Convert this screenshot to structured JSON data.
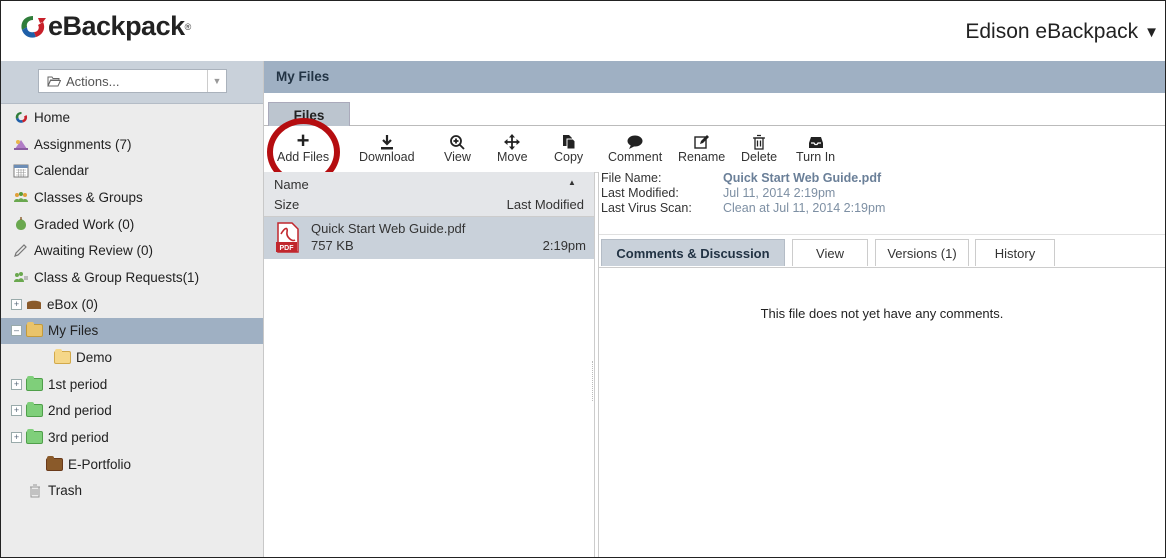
{
  "header": {
    "logo_text": "eBackpack",
    "logo_reg": "®",
    "user_menu": "Edison eBackpack"
  },
  "sidebar": {
    "actions_label": "Actions...",
    "items": [
      {
        "label": "Home",
        "icon": "home-logo-icon"
      },
      {
        "label": "Assignments (7)",
        "icon": "assignments-icon"
      },
      {
        "label": "Calendar",
        "icon": "calendar-icon"
      },
      {
        "label": "Classes & Groups",
        "icon": "classes-groups-icon"
      },
      {
        "label": "Graded Work (0)",
        "icon": "graded-work-icon"
      },
      {
        "label": "Awaiting Review (0)",
        "icon": "pencil-icon"
      },
      {
        "label": "Class & Group Requests(1)",
        "icon": "group-requests-icon"
      },
      {
        "label": "eBox (0)",
        "icon": "ebox-icon"
      },
      {
        "label": "My Files",
        "icon": "folder-icon"
      },
      {
        "label": "Demo",
        "icon": "folder-icon"
      },
      {
        "label": "1st period",
        "icon": "folder-icon"
      },
      {
        "label": "2nd period",
        "icon": "folder-icon"
      },
      {
        "label": "3rd period",
        "icon": "folder-icon"
      },
      {
        "label": "E-Portfolio",
        "icon": "portfolio-icon"
      },
      {
        "label": "Trash",
        "icon": "trash-icon"
      }
    ]
  },
  "main": {
    "title": "My Files",
    "tab": "Files",
    "toolbar": {
      "add_files": "Add Files",
      "download": "Download",
      "view": "View",
      "move": "Move",
      "copy": "Copy",
      "comment": "Comment",
      "rename": "Rename",
      "delete": "Delete",
      "turn_in": "Turn In"
    },
    "filelist": {
      "col_name": "Name",
      "col_size": "Size",
      "col_modified": "Last Modified",
      "file": {
        "name": "Quick Start Web Guide.pdf",
        "size": "757 KB",
        "modified": "2:19pm",
        "icon_label": "PDF"
      }
    },
    "details": {
      "file_name_label": "File Name:",
      "file_name": "Quick Start Web Guide.pdf",
      "last_modified_label": "Last Modified:",
      "last_modified": "Jul 11, 2014 2:19pm",
      "virus_scan_label": "Last Virus Scan:",
      "virus_scan": "Clean at Jul 11, 2014 2:19pm",
      "tabs": [
        "Comments & Discussion",
        "View",
        "Versions (1)",
        "History"
      ],
      "empty_message": "This file does not yet have any comments."
    }
  },
  "colors": {
    "brand_red": "#b50d10",
    "header_blue": "#9fb0c3",
    "selection": "#c9d1da",
    "link_blue": "#7d8fa3"
  }
}
